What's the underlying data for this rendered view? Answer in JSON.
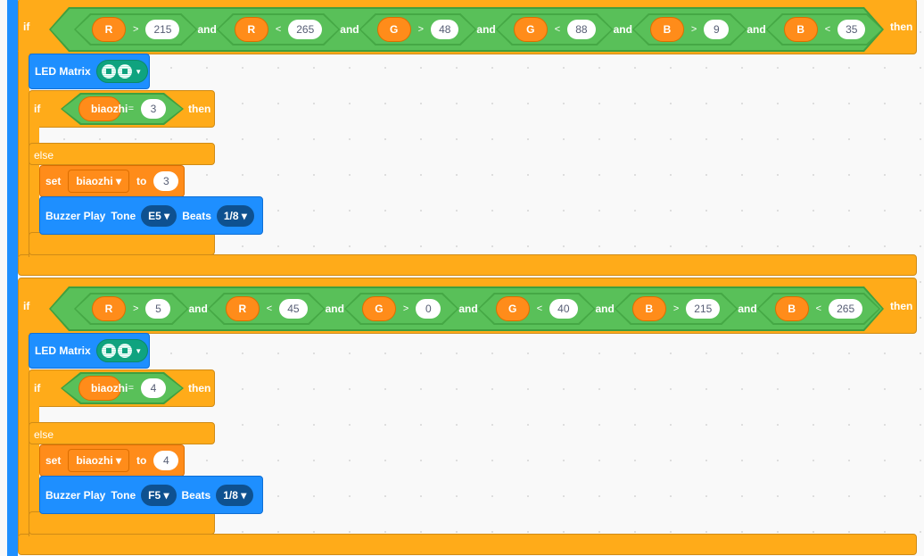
{
  "colors": {
    "control": "#ffab19",
    "operator": "#59c059",
    "variable": "#ff8c1a",
    "extension": "#1e8fff"
  },
  "blocks": [
    {
      "if_label": "if",
      "then_label": "then",
      "conditions": [
        {
          "var": "R",
          "op": ">",
          "value": "215"
        },
        {
          "var": "R",
          "op": "<",
          "value": "265"
        },
        {
          "var": "G",
          "op": ">",
          "value": "48"
        },
        {
          "var": "G",
          "op": "<",
          "value": "88"
        },
        {
          "var": "B",
          "op": ">",
          "value": "9"
        },
        {
          "var": "B",
          "op": "<",
          "value": "35"
        }
      ],
      "and_label": "and",
      "led_label": "LED Matrix",
      "inner_if": {
        "if_label": "if",
        "var": "biaozhi",
        "op": "=",
        "value": "3",
        "then_label": "then"
      },
      "else_label": "else",
      "set": {
        "label": "set",
        "var": "biaozhi ▾",
        "to_label": "to",
        "value": "3"
      },
      "buzzer": {
        "label": "Buzzer Play",
        "tone_label": "Tone",
        "tone": "E5 ▾",
        "beats_label": "Beats",
        "beats": "1/8 ▾"
      }
    },
    {
      "if_label": "if",
      "then_label": "then",
      "conditions": [
        {
          "var": "R",
          "op": ">",
          "value": "5"
        },
        {
          "var": "R",
          "op": "<",
          "value": "45"
        },
        {
          "var": "G",
          "op": ">",
          "value": "0"
        },
        {
          "var": "G",
          "op": "<",
          "value": "40"
        },
        {
          "var": "B",
          "op": ">",
          "value": "215"
        },
        {
          "var": "B",
          "op": "<",
          "value": "265"
        }
      ],
      "and_label": "and",
      "led_label": "LED Matrix",
      "inner_if": {
        "if_label": "if",
        "var": "biaozhi",
        "op": "=",
        "value": "4",
        "then_label": "then"
      },
      "else_label": "else",
      "set": {
        "label": "set",
        "var": "biaozhi ▾",
        "to_label": "to",
        "value": "4"
      },
      "buzzer": {
        "label": "Buzzer Play",
        "tone_label": "Tone",
        "tone": "F5 ▾",
        "beats_label": "Beats",
        "beats": "1/8 ▾"
      }
    }
  ]
}
